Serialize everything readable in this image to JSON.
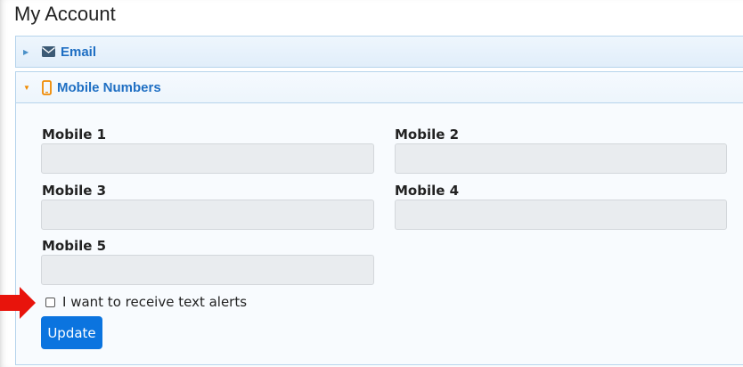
{
  "page": {
    "title": "My Account"
  },
  "sections": {
    "email": {
      "label": "Email",
      "icon": "envelope-icon",
      "expanded": false
    },
    "mobile": {
      "label": "Mobile Numbers",
      "icon": "mobile-phone-icon",
      "expanded": true
    }
  },
  "form": {
    "fields": [
      {
        "label": "Mobile 1",
        "value": ""
      },
      {
        "label": "Mobile 2",
        "value": ""
      },
      {
        "label": "Mobile 3",
        "value": ""
      },
      {
        "label": "Mobile 4",
        "value": ""
      },
      {
        "label": "Mobile 5",
        "value": ""
      }
    ],
    "text_alerts_label": "I want to receive text alerts",
    "text_alerts_checked": false,
    "update_label": "Update"
  },
  "colors": {
    "accent": "#0b74df",
    "header_text": "#1f6fc3",
    "caret_open": "#f08a00",
    "annotation_arrow": "#e8140c"
  }
}
